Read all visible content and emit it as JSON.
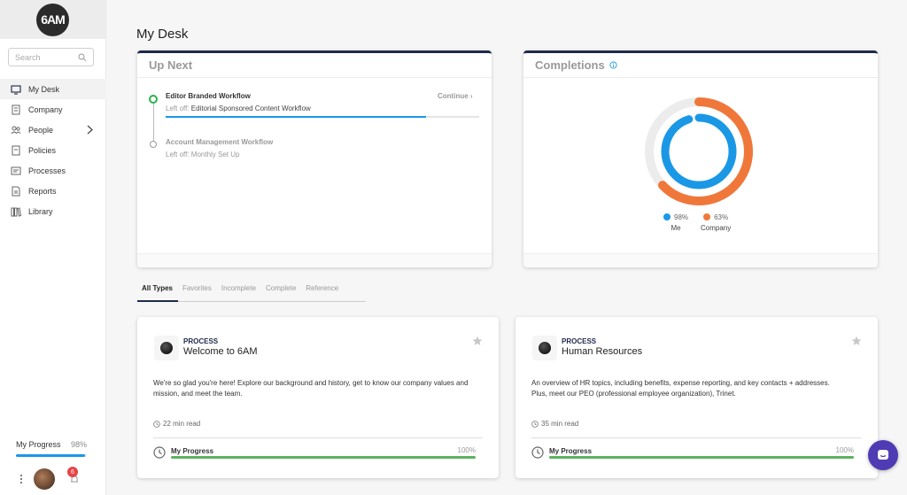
{
  "sidebar": {
    "logo": "6AM",
    "search_placeholder": "Search",
    "items": [
      {
        "label": "My Desk",
        "icon": "monitor-icon",
        "active": true
      },
      {
        "label": "Company",
        "icon": "building-icon"
      },
      {
        "label": "People",
        "icon": "people-icon"
      },
      {
        "label": "Policies",
        "icon": "document-icon"
      },
      {
        "label": "Processes",
        "icon": "processes-icon"
      },
      {
        "label": "Reports",
        "icon": "report-icon"
      },
      {
        "label": "Library",
        "icon": "library-icon"
      }
    ],
    "progress": {
      "label": "My Progress",
      "value": "98%",
      "fraction": 0.98
    },
    "notification_count": "6"
  },
  "page": {
    "title": "My Desk"
  },
  "up_next": {
    "title": "Up Next",
    "workflows": [
      {
        "title": "Editor Branded Workflow",
        "left_off_label": "Left off:",
        "left_off": "Editorial Sponsored Content Workflow",
        "action": "Continue ›",
        "progress": 0.83
      },
      {
        "title": "Account Management Workflow",
        "left_off_label": "Left off:",
        "left_off": "Monthly Set Up"
      }
    ]
  },
  "completions": {
    "title": "Completions",
    "series": [
      {
        "name": "Me",
        "value": "98%",
        "fraction": 0.98,
        "color": "#1a98e6"
      },
      {
        "name": "Company",
        "value": "63%",
        "fraction": 0.63,
        "color": "#f0773a"
      }
    ]
  },
  "tabs": [
    "All Types",
    "Favorites",
    "Incomplete",
    "Complete",
    "Reference"
  ],
  "processes": [
    {
      "type": "PROCESS",
      "name": "Welcome to 6AM",
      "description": "We're so glad you're here! Explore our background and history, get to know our company values and mission, and meet the team.",
      "read_time": "22 min read",
      "progress_label": "My Progress",
      "progress_value": "100%",
      "fraction": 1.0
    },
    {
      "type": "PROCESS",
      "name": "Human Resources",
      "description": "An overview of HR topics, including benefits, expense reporting, and key contacts + addresses. Plus, meet our PEO (professional employee organization), Trinet.",
      "read_time": "35 min read",
      "progress_label": "My Progress",
      "progress_value": "100%",
      "fraction": 1.0
    }
  ],
  "colors": {
    "accent": "#1a98e6",
    "navy": "#1e2a4a",
    "orange": "#f0773a",
    "green": "#5bb35f",
    "chat": "#4f3bb4"
  }
}
